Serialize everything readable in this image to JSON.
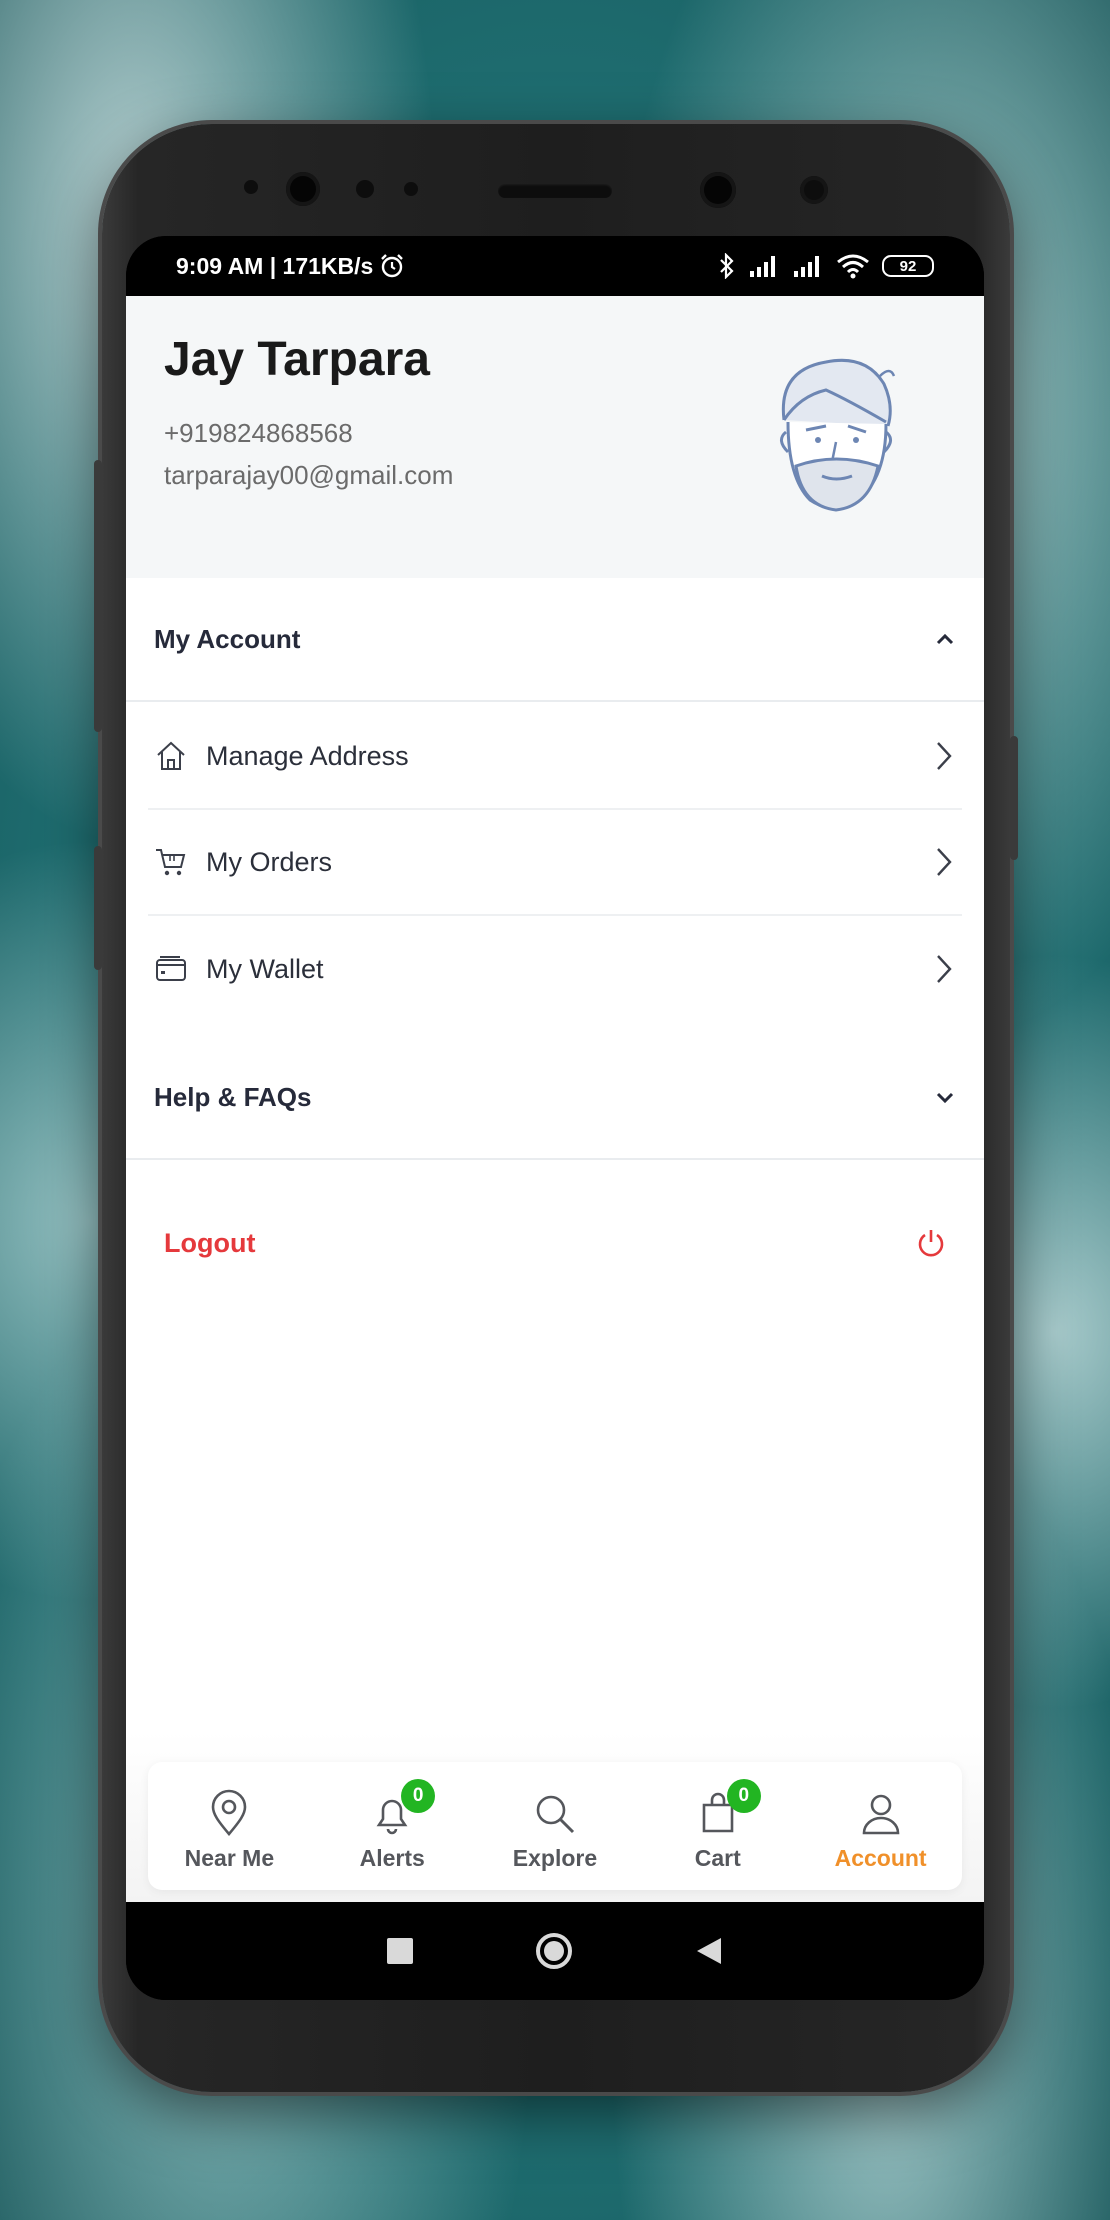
{
  "status_bar": {
    "time_speed": "9:09 AM | 171KB/s",
    "battery": "92"
  },
  "profile": {
    "name": "Jay Tarpara",
    "phone": "+919824868568",
    "email": "tarparajay00@gmail.com"
  },
  "my_account": {
    "title": "My Account",
    "expanded": true,
    "items": [
      {
        "label": "Manage Address",
        "icon": "home-icon"
      },
      {
        "label": "My Orders",
        "icon": "cart-icon"
      },
      {
        "label": "My Wallet",
        "icon": "wallet-icon"
      }
    ]
  },
  "help": {
    "title": "Help & FAQs",
    "expanded": false
  },
  "logout": {
    "label": "Logout",
    "color": "#e5393c"
  },
  "bottom_nav": {
    "active_color": "#f0902a",
    "badge_color": "#22b522",
    "items": [
      {
        "label": "Near Me",
        "icon": "location-pin-icon"
      },
      {
        "label": "Alerts",
        "icon": "bell-icon",
        "badge": "0"
      },
      {
        "label": "Explore",
        "icon": "search-icon"
      },
      {
        "label": "Cart",
        "icon": "shopping-bag-icon",
        "badge": "0"
      },
      {
        "label": "Account",
        "icon": "user-icon",
        "active": true
      }
    ]
  }
}
